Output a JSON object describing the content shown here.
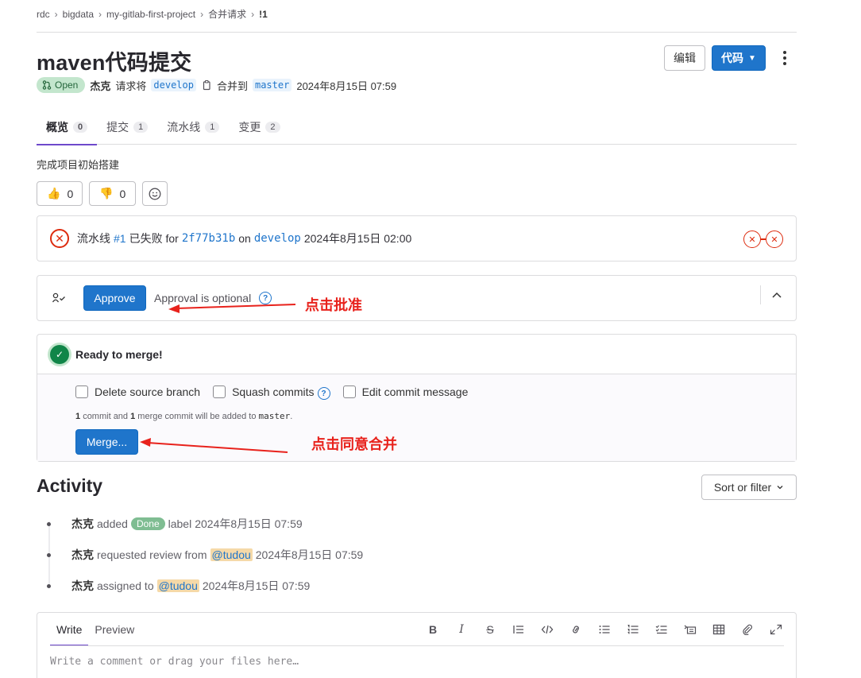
{
  "breadcrumb": {
    "items": [
      "rdc",
      "bigdata",
      "my-gitlab-first-project",
      "合并请求",
      "!1"
    ],
    "separator": "›"
  },
  "title": "maven代码提交",
  "actions": {
    "edit_label": "编辑",
    "code_label": "代码"
  },
  "meta": {
    "status": "Open",
    "author": "杰克",
    "request_text": "请求将",
    "source_branch": "develop",
    "merge_into_text": "合并到",
    "target_branch": "master",
    "timestamp": "2024年8月15日 07:59"
  },
  "tabs": [
    {
      "label": "概览",
      "count": "0",
      "active": true
    },
    {
      "label": "提交",
      "count": "1"
    },
    {
      "label": "流水线",
      "count": "1"
    },
    {
      "label": "变更",
      "count": "2"
    }
  ],
  "description": "完成项目初始搭建",
  "reactions": {
    "thumbs_up": "0",
    "thumbs_down": "0"
  },
  "pipeline": {
    "prefix": "流水线",
    "id": "#1",
    "status_text": "已失败 for",
    "commit": "2f77b31b",
    "on_text": "on",
    "branch": "develop",
    "timestamp": "2024年8月15日 02:00"
  },
  "approval": {
    "button_label": "Approve",
    "text": "Approval is optional"
  },
  "merge": {
    "status": "Ready to merge!",
    "options": [
      "Delete source branch",
      "Squash commits",
      "Edit commit message"
    ],
    "note": {
      "n1": "1",
      "t1": "commit and",
      "n2": "1",
      "t2": "merge commit will be added to",
      "branch": "master",
      "end": "."
    },
    "button_label": "Merge..."
  },
  "annotations": {
    "approve_hint": "点击批准",
    "merge_hint": "点击同意合并"
  },
  "activity": {
    "title": "Activity",
    "sort_label": "Sort or filter",
    "items": [
      {
        "who": "杰克",
        "pre": "added",
        "label": "Done",
        "post": "label",
        "time": "2024年8月15日 07:59"
      },
      {
        "who": "杰克",
        "pre": "requested review from",
        "mention": "@tudou",
        "time": "2024年8月15日 07:59"
      },
      {
        "who": "杰克",
        "pre": "assigned to",
        "mention": "@tudou",
        "time": "2024年8月15日 07:59"
      }
    ]
  },
  "comment": {
    "write_tab": "Write",
    "preview_tab": "Preview",
    "placeholder": "Write a comment or drag your files here…",
    "tools": [
      "bold-icon",
      "italic-icon",
      "strikethrough-icon",
      "quote-icon",
      "code-icon",
      "link-icon",
      "bullet-list-icon",
      "numbered-list-icon",
      "task-list-icon",
      "collapsible-icon",
      "table-icon",
      "attach-icon",
      "fullscreen-icon"
    ]
  },
  "colors": {
    "primary": "#1f75cb",
    "danger": "#dd2b0e",
    "success": "#108548",
    "annotation": "#e8221c",
    "tab_accent": "#6e49cb"
  }
}
